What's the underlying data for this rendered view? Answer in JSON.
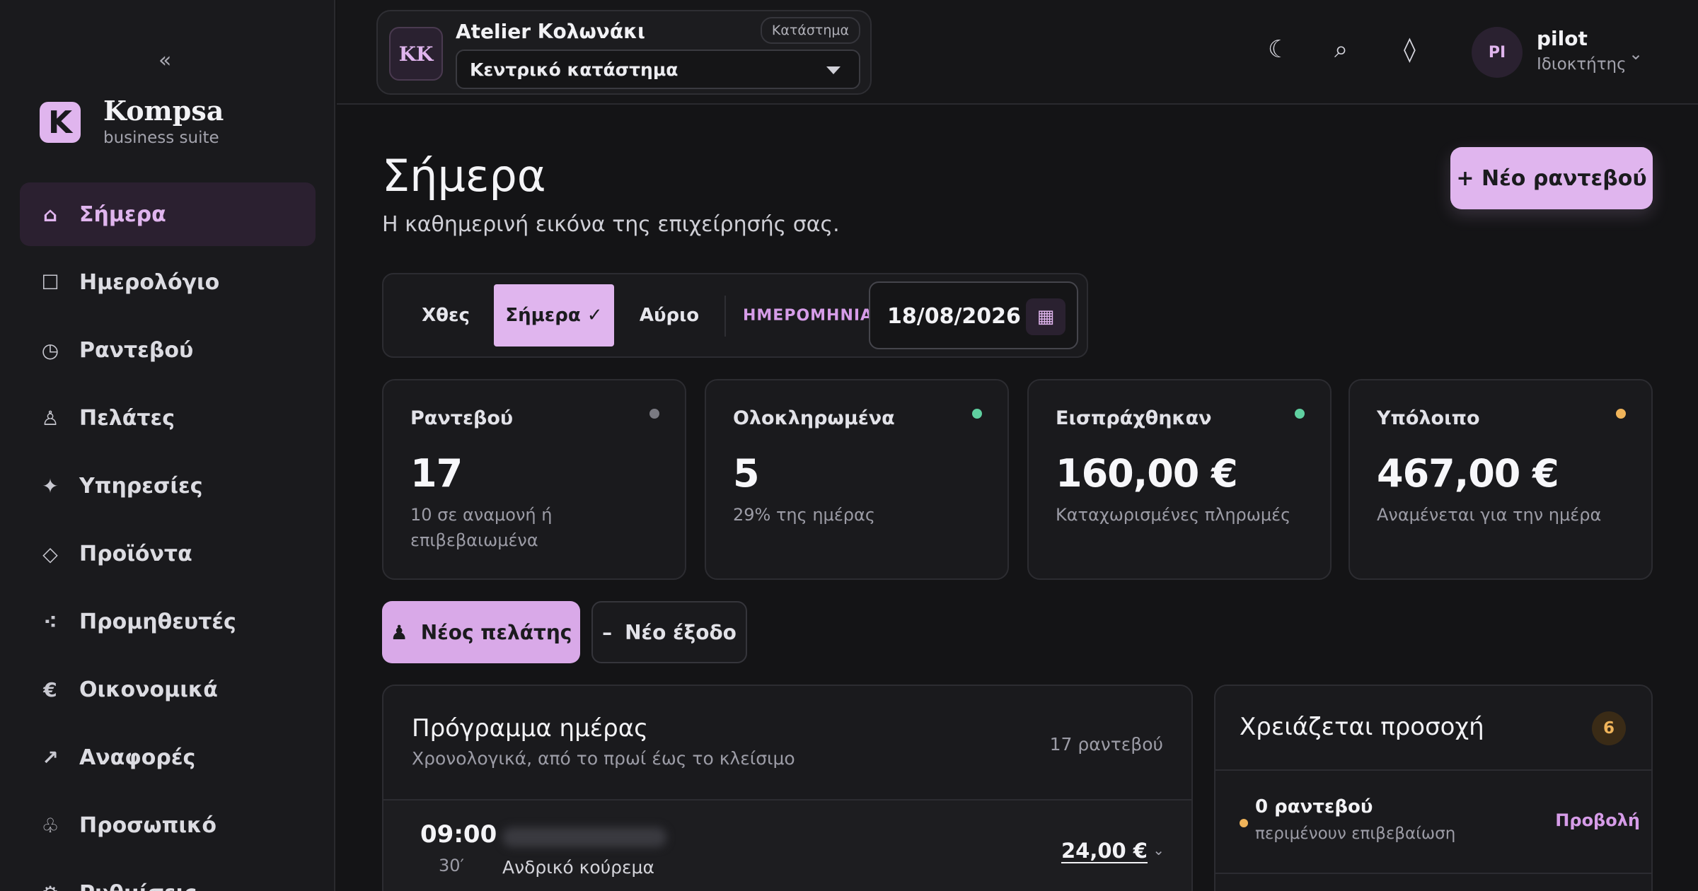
{
  "sidebar": {
    "collapse_label": "«",
    "brand": {
      "logo_letter": "K",
      "name": "Kompsa",
      "subtitle": "business suite"
    },
    "items": [
      {
        "label": "Σήμερα",
        "icon": "home-icon",
        "glyph": "⌂",
        "active": true
      },
      {
        "label": "Ημερολόγιο",
        "icon": "calendar-icon",
        "glyph": "☐",
        "active": false
      },
      {
        "label": "Ραντεβού",
        "icon": "clock-icon",
        "glyph": "◷",
        "active": false
      },
      {
        "label": "Πελάτες",
        "icon": "person-icon",
        "glyph": "♙",
        "active": false
      },
      {
        "label": "Υπηρεσίες",
        "icon": "sparkle-icon",
        "glyph": "✦",
        "active": false
      },
      {
        "label": "Προϊόντα",
        "icon": "diamond-icon",
        "glyph": "◇",
        "active": false
      },
      {
        "label": "Προμηθευτές",
        "icon": "dots-icon",
        "glyph": "⁖",
        "active": false
      },
      {
        "label": "Οικονομικά",
        "icon": "euro-icon",
        "glyph": "€",
        "active": false
      },
      {
        "label": "Αναφορές",
        "icon": "arrow-up-right-icon",
        "glyph": "↗",
        "active": false
      },
      {
        "label": "Προσωπικό",
        "icon": "staff-icon",
        "glyph": "♧",
        "active": false
      },
      {
        "label": "Ρυθμίσεις",
        "icon": "settings-icon",
        "glyph": "⚙",
        "active": false
      }
    ]
  },
  "topbar": {
    "store": {
      "initials": "KK",
      "name": "Atelier Κολωνάκι",
      "tag": "Κατάστημα",
      "selected_branch": "Κεντρικό κατάστημα"
    },
    "icons": {
      "theme": "☾",
      "search": "⌕",
      "diamond": "◊"
    },
    "user": {
      "initials": "PI",
      "name": "pilot",
      "role": "Ιδιοκτήτης",
      "chevron": "⌄"
    }
  },
  "main": {
    "title": "Σήμερα",
    "subtitle": "Η καθημερινή εικόνα της επιχείρησής σας.",
    "new_appointment_label": "+ Νέο ραντεβού",
    "day_tabs": {
      "yesterday": "Χθες",
      "today": "Σήμερα ✓",
      "tomorrow": "Αύριο",
      "date_label": "ΗΜΕΡΟΜΗΝΙΑ",
      "date_value": "18/08/2026",
      "calendar_glyph": "▦"
    },
    "stats": [
      {
        "label": "Ραντεβού",
        "value": "17",
        "sub": "10 σε αναμονή ή επιβεβαιωμένα",
        "dot_color": "#7a7a82"
      },
      {
        "label": "Ολοκληρωμένα",
        "value": "5",
        "sub": "29% της ημέρας",
        "dot_color": "#5fd0a0"
      },
      {
        "label": "Εισπράχθηκαν",
        "value": "160,00 €",
        "sub": "Καταχωρισμένες πληρωμές",
        "dot_color": "#5fd0a0"
      },
      {
        "label": "Υπόλοιπο",
        "value": "467,00 €",
        "sub": "Αναμένεται για την ημέρα",
        "dot_color": "#f0b45a"
      }
    ],
    "actions": {
      "new_client": "Νέος πελάτης",
      "new_client_icon": "♟",
      "new_expense": "Νέο έξοδο",
      "new_expense_icon": "–"
    },
    "schedule": {
      "title": "Πρόγραμμα ημέρας",
      "subtitle": "Χρονολογικά, από το πρωί έως το κλείσιμο",
      "count": "17 ραντεβού",
      "rows": [
        {
          "time": "09:00",
          "duration": "30′",
          "service": "Ανδρικό κούρεμα",
          "price": "24,00 €"
        }
      ]
    },
    "attention": {
      "title": "Χρειάζεται προσοχή",
      "badge": "6",
      "items": [
        {
          "main": "0 ραντεβού",
          "sub": "περιμένουν επιβεβαίωση",
          "link": "Προβολή"
        }
      ]
    }
  },
  "colors": {
    "accent": "#e0b5ee",
    "warning": "#f0b45a",
    "success": "#5fd0a0",
    "bg": "#141416"
  }
}
